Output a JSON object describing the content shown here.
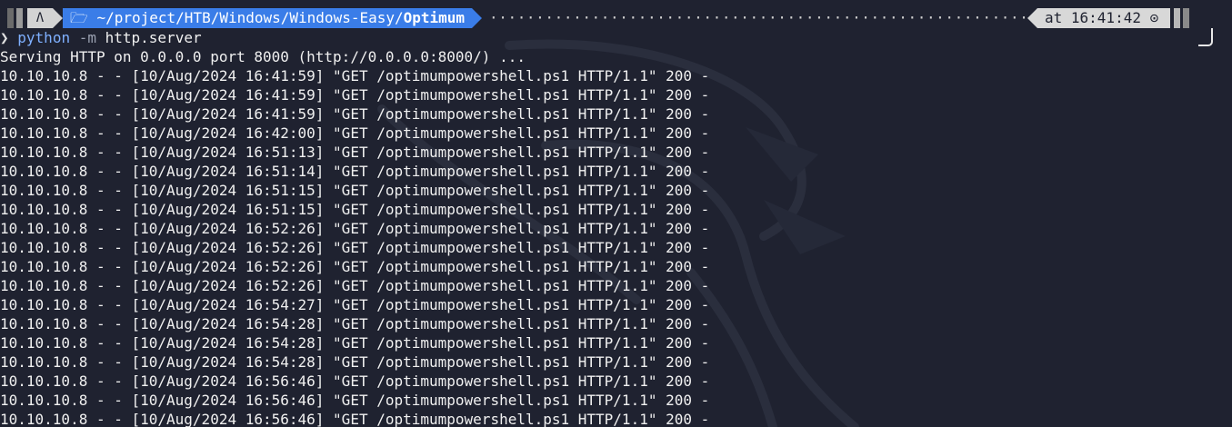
{
  "prompt": {
    "os_icon": "Λ",
    "folder_icon": "🗁",
    "path_prefix": " ~/project/HTB/Windows/Windows-Easy/",
    "path_current": "Optimum",
    "dots": "·······································································································",
    "time_label": "at 16:41:42",
    "clock_icon": "⊙",
    "colors": {
      "path_bg": "#3a7de8",
      "os_bg": "#d3d3d3",
      "time_bg": "#d8d8d8",
      "background": "#1f2230"
    }
  },
  "command": {
    "prompt_symbol": "❯",
    "program": "python",
    "flag": "-m",
    "args": "http.server"
  },
  "output": {
    "serving_line": "Serving HTTP on 0.0.0.0 port 8000 (http://0.0.0.0:8000/) ...",
    "log_lines": [
      "10.10.10.8 - - [10/Aug/2024 16:41:59] \"GET /optimumpowershell.ps1 HTTP/1.1\" 200 -",
      "10.10.10.8 - - [10/Aug/2024 16:41:59] \"GET /optimumpowershell.ps1 HTTP/1.1\" 200 -",
      "10.10.10.8 - - [10/Aug/2024 16:41:59] \"GET /optimumpowershell.ps1 HTTP/1.1\" 200 -",
      "10.10.10.8 - - [10/Aug/2024 16:42:00] \"GET /optimumpowershell.ps1 HTTP/1.1\" 200 -",
      "10.10.10.8 - - [10/Aug/2024 16:51:13] \"GET /optimumpowershell.ps1 HTTP/1.1\" 200 -",
      "10.10.10.8 - - [10/Aug/2024 16:51:14] \"GET /optimumpowershell.ps1 HTTP/1.1\" 200 -",
      "10.10.10.8 - - [10/Aug/2024 16:51:15] \"GET /optimumpowershell.ps1 HTTP/1.1\" 200 -",
      "10.10.10.8 - - [10/Aug/2024 16:51:15] \"GET /optimumpowershell.ps1 HTTP/1.1\" 200 -",
      "10.10.10.8 - - [10/Aug/2024 16:52:26] \"GET /optimumpowershell.ps1 HTTP/1.1\" 200 -",
      "10.10.10.8 - - [10/Aug/2024 16:52:26] \"GET /optimumpowershell.ps1 HTTP/1.1\" 200 -",
      "10.10.10.8 - - [10/Aug/2024 16:52:26] \"GET /optimumpowershell.ps1 HTTP/1.1\" 200 -",
      "10.10.10.8 - - [10/Aug/2024 16:52:26] \"GET /optimumpowershell.ps1 HTTP/1.1\" 200 -",
      "10.10.10.8 - - [10/Aug/2024 16:54:27] \"GET /optimumpowershell.ps1 HTTP/1.1\" 200 -",
      "10.10.10.8 - - [10/Aug/2024 16:54:28] \"GET /optimumpowershell.ps1 HTTP/1.1\" 200 -",
      "10.10.10.8 - - [10/Aug/2024 16:54:28] \"GET /optimumpowershell.ps1 HTTP/1.1\" 200 -",
      "10.10.10.8 - - [10/Aug/2024 16:54:28] \"GET /optimumpowershell.ps1 HTTP/1.1\" 200 -",
      "10.10.10.8 - - [10/Aug/2024 16:56:46] \"GET /optimumpowershell.ps1 HTTP/1.1\" 200 -",
      "10.10.10.8 - - [10/Aug/2024 16:56:46] \"GET /optimumpowershell.ps1 HTTP/1.1\" 200 -",
      "10.10.10.8 - - [10/Aug/2024 16:56:46] \"GET /optimumpowershell.ps1 HTTP/1.1\" 200 -"
    ]
  }
}
